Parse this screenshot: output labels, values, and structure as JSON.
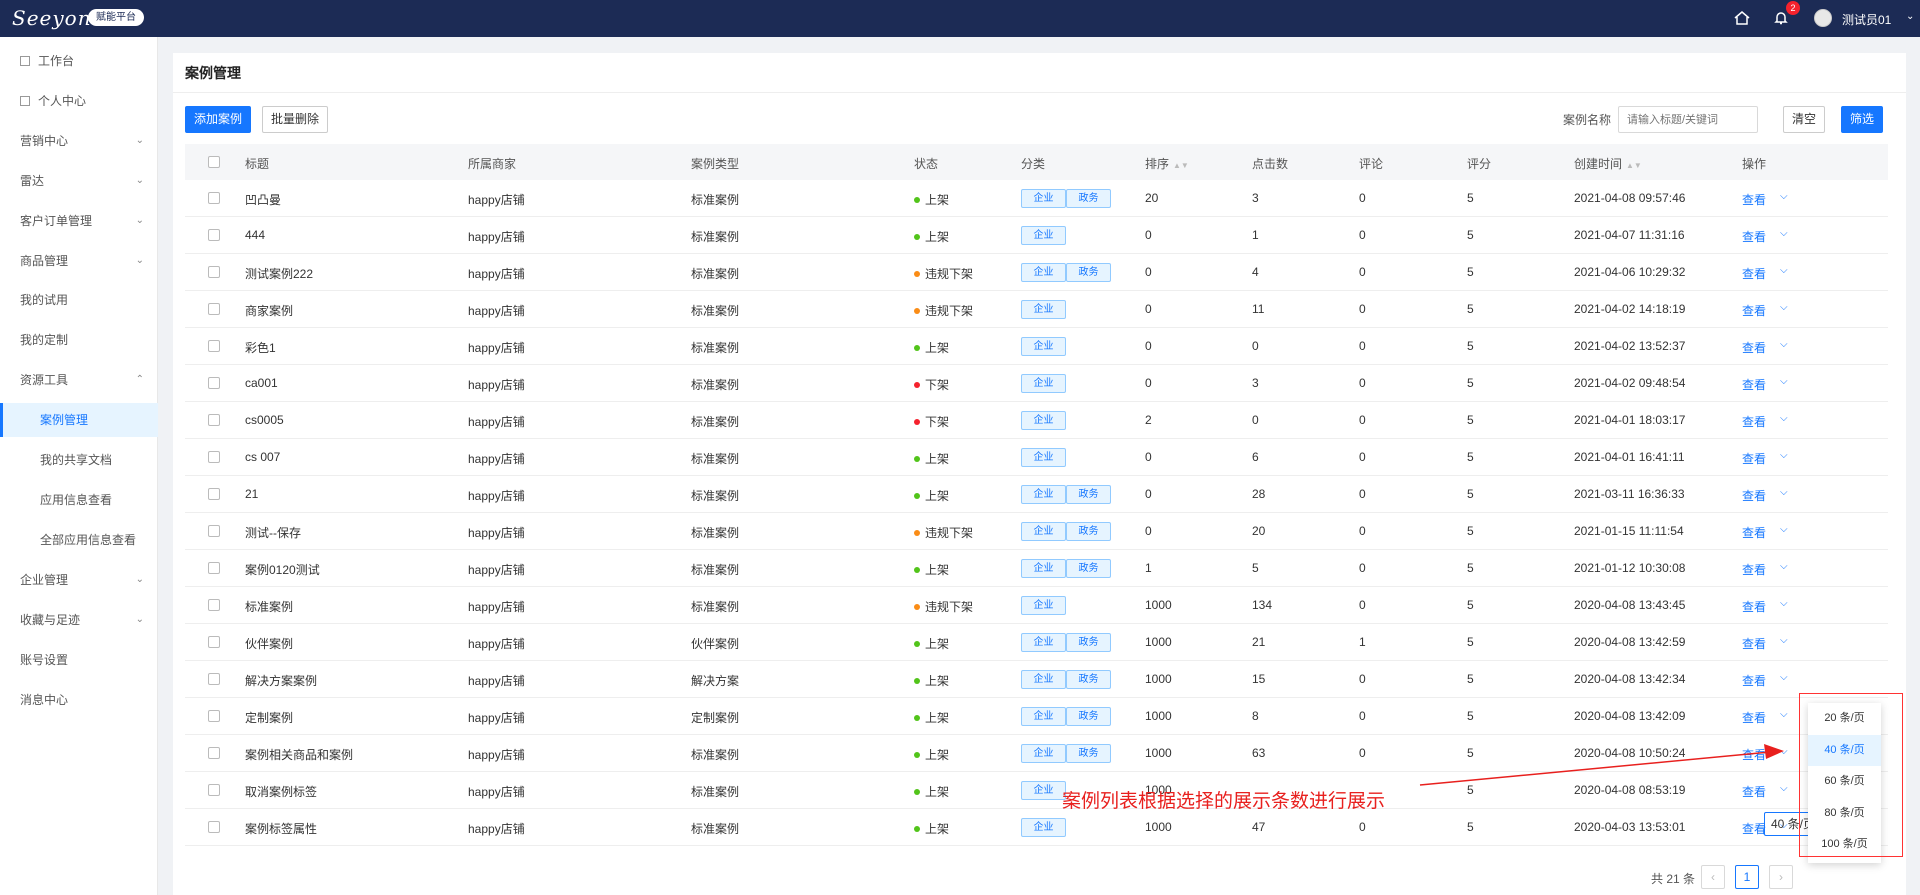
{
  "topbar": {
    "logo_text": "Seeyon",
    "platform_badge": "赋能平台",
    "notification_count": "2",
    "username": "测试员01"
  },
  "sidebar": {
    "items": [
      {
        "label": "工作台",
        "icon": "grid-icon"
      },
      {
        "label": "个人中心",
        "icon": "user-icon"
      },
      {
        "label": "营销中心",
        "caret": "⌄"
      },
      {
        "label": "雷达",
        "caret": "⌄"
      },
      {
        "label": "客户订单管理",
        "caret": "⌄"
      },
      {
        "label": "商品管理",
        "caret": "⌄"
      },
      {
        "label": "我的试用"
      },
      {
        "label": "我的定制"
      },
      {
        "label": "资源工具",
        "caret": "⌃"
      },
      {
        "label": "案例管理",
        "sub": true,
        "active": true
      },
      {
        "label": "我的共享文档",
        "sub": true
      },
      {
        "label": "应用信息查看",
        "sub": true
      },
      {
        "label": "全部应用信息查看",
        "sub": true
      },
      {
        "label": "企业管理",
        "caret": "⌄"
      },
      {
        "label": "收藏与足迹",
        "caret": "⌄"
      },
      {
        "label": "账号设置"
      },
      {
        "label": "消息中心"
      }
    ]
  },
  "main": {
    "title": "案例管理",
    "add_button": "添加案例",
    "batch_delete_button": "批量删除",
    "filter_label": "案例名称",
    "filter_placeholder": "请输入标题/关键词",
    "clear_button": "清空",
    "filter_button": "筛选"
  },
  "table": {
    "headers": [
      "标题",
      "所属商家",
      "案例类型",
      "状态",
      "分类",
      "排序",
      "点击数",
      "评论",
      "评分",
      "创建时间",
      "操作"
    ],
    "rows": [
      {
        "title": "凹凸曼",
        "shop": "happy店铺",
        "type": "标准案例",
        "status": "上架",
        "tags": [
          "企业",
          "政务"
        ],
        "sort": "20",
        "clicks": "3",
        "comments": "0",
        "rating": "5",
        "created": "2021-04-08 09:57:46"
      },
      {
        "title": "444",
        "shop": "happy店铺",
        "type": "标准案例",
        "status": "上架",
        "tags": [
          "企业"
        ],
        "sort": "0",
        "clicks": "1",
        "comments": "0",
        "rating": "5",
        "created": "2021-04-07 11:31:16"
      },
      {
        "title": "测试案例222",
        "shop": "happy店铺",
        "type": "标准案例",
        "status": "违规下架",
        "tags": [
          "企业",
          "政务"
        ],
        "sort": "0",
        "clicks": "4",
        "comments": "0",
        "rating": "5",
        "created": "2021-04-06 10:29:32"
      },
      {
        "title": "商家案例",
        "shop": "happy店铺",
        "type": "标准案例",
        "status": "违规下架",
        "tags": [
          "企业"
        ],
        "sort": "0",
        "clicks": "11",
        "comments": "0",
        "rating": "5",
        "created": "2021-04-02 14:18:19"
      },
      {
        "title": "彩色1",
        "shop": "happy店铺",
        "type": "标准案例",
        "status": "上架",
        "tags": [
          "企业"
        ],
        "sort": "0",
        "clicks": "0",
        "comments": "0",
        "rating": "5",
        "created": "2021-04-02 13:52:37"
      },
      {
        "title": "ca001",
        "shop": "happy店铺",
        "type": "标准案例",
        "status": "下架",
        "tags": [
          "企业"
        ],
        "sort": "0",
        "clicks": "3",
        "comments": "0",
        "rating": "5",
        "created": "2021-04-02 09:48:54"
      },
      {
        "title": "cs0005",
        "shop": "happy店铺",
        "type": "标准案例",
        "status": "下架",
        "tags": [
          "企业"
        ],
        "sort": "2",
        "clicks": "0",
        "comments": "0",
        "rating": "5",
        "created": "2021-04-01 18:03:17"
      },
      {
        "title": "cs 007",
        "shop": "happy店铺",
        "type": "标准案例",
        "status": "上架",
        "tags": [
          "企业"
        ],
        "sort": "0",
        "clicks": "6",
        "comments": "0",
        "rating": "5",
        "created": "2021-04-01 16:41:11"
      },
      {
        "title": "21",
        "shop": "happy店铺",
        "type": "标准案例",
        "status": "上架",
        "tags": [
          "企业",
          "政务"
        ],
        "sort": "0",
        "clicks": "28",
        "comments": "0",
        "rating": "5",
        "created": "2021-03-11 16:36:33"
      },
      {
        "title": "测试--保存",
        "shop": "happy店铺",
        "type": "标准案例",
        "status": "违规下架",
        "tags": [
          "企业",
          "政务"
        ],
        "sort": "0",
        "clicks": "20",
        "comments": "0",
        "rating": "5",
        "created": "2021-01-15 11:11:54"
      },
      {
        "title": "案例0120测试",
        "shop": "happy店铺",
        "type": "标准案例",
        "status": "上架",
        "tags": [
          "企业",
          "政务"
        ],
        "sort": "1",
        "clicks": "5",
        "comments": "0",
        "rating": "5",
        "created": "2021-01-12 10:30:08"
      },
      {
        "title": "标准案例",
        "shop": "happy店铺",
        "type": "标准案例",
        "status": "违规下架",
        "tags": [
          "企业"
        ],
        "sort": "1000",
        "clicks": "134",
        "comments": "0",
        "rating": "5",
        "created": "2020-04-08 13:43:45"
      },
      {
        "title": "伙伴案例",
        "shop": "happy店铺",
        "type": "伙伴案例",
        "status": "上架",
        "tags": [
          "企业",
          "政务"
        ],
        "sort": "1000",
        "clicks": "21",
        "comments": "1",
        "rating": "5",
        "created": "2020-04-08 13:42:59"
      },
      {
        "title": "解决方案案例",
        "shop": "happy店铺",
        "type": "解决方案",
        "status": "上架",
        "tags": [
          "企业",
          "政务"
        ],
        "sort": "1000",
        "clicks": "15",
        "comments": "0",
        "rating": "5",
        "created": "2020-04-08 13:42:34"
      },
      {
        "title": "定制案例",
        "shop": "happy店铺",
        "type": "定制案例",
        "status": "上架",
        "tags": [
          "企业",
          "政务"
        ],
        "sort": "1000",
        "clicks": "8",
        "comments": "0",
        "rating": "5",
        "created": "2020-04-08 13:42:09"
      },
      {
        "title": "案例相关商品和案例",
        "shop": "happy店铺",
        "type": "标准案例",
        "status": "上架",
        "tags": [
          "企业",
          "政务"
        ],
        "sort": "1000",
        "clicks": "63",
        "comments": "0",
        "rating": "5",
        "created": "2020-04-08 10:50:24"
      },
      {
        "title": "取消案例标签",
        "shop": "happy店铺",
        "type": "标准案例",
        "status": "上架",
        "tags": [
          "企业"
        ],
        "sort": "1000",
        "clicks": "",
        "comments": "",
        "rating": "5",
        "created": "2020-04-08 08:53:19"
      },
      {
        "title": "案例标签属性",
        "shop": "happy店铺",
        "type": "标准案例",
        "status": "上架",
        "tags": [
          "企业"
        ],
        "sort": "1000",
        "clicks": "47",
        "comments": "0",
        "rating": "5",
        "created": "2020-04-03 13:53:01"
      }
    ],
    "action_label": "查看"
  },
  "status_colors": {
    "上架": "#52c41a",
    "下架": "#f5222d",
    "违规下架": "#fa8c16"
  },
  "pagination": {
    "total": "共 21 条",
    "current_page": "1",
    "page_size": "40 条/页"
  },
  "page_size_options": [
    "20 条/页",
    "40 条/页",
    "60 条/页",
    "80 条/页",
    "100 条/页"
  ],
  "selected_page_size": "40 条/页",
  "annotation": "案例列表根据选择的展示条数进行展示"
}
